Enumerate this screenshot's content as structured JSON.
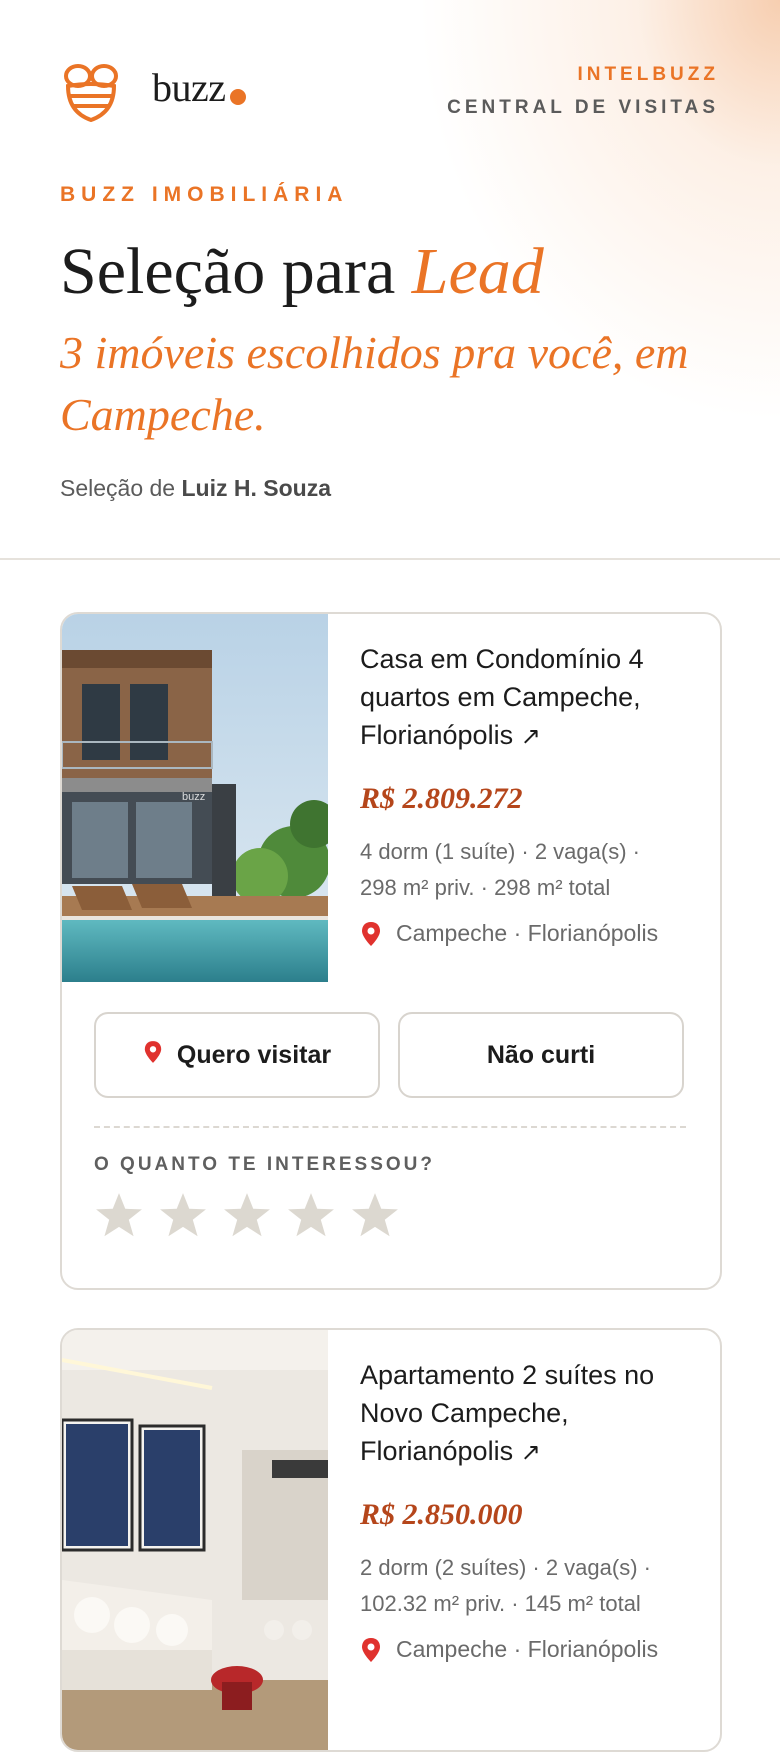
{
  "header": {
    "logo_text": "buzz",
    "brand": "INTELBUZZ",
    "brand_subtitle": "CENTRAL DE VISITAS",
    "agency": "BUZZ IMOBILIÁRIA",
    "headline_prefix": "Seleção para ",
    "headline_name": "Lead",
    "subheadline": "3 imóveis escolhidos pra você, em Campeche.",
    "curator_prefix": "Seleção de ",
    "curator_name": "Luiz H. Souza"
  },
  "colors": {
    "accent": "#ea7426",
    "price": "#b5461b",
    "text": "#1c1c1c",
    "muted": "#6a6a6a",
    "star_empty": "#dcd8d0"
  },
  "listings": [
    {
      "title": "Casa em Condomínio 4 quartos em Campeche, Florianópolis",
      "link_icon": "external-arrow-icon",
      "price": "R$ 2.809.272",
      "specs_line1": "4 dorm (1 suíte) · 2 vaga(s) ·",
      "specs_line2": "298 m² priv. · 298 m² total",
      "location": "Campeche · Florianópolis",
      "photo_watermark": "buzz",
      "visit_label": "Quero visitar",
      "dislike_label": "Não curti",
      "rating_label": "O QUANTO TE INTERESSOU?",
      "rating": 0,
      "rating_max": 5
    },
    {
      "title": "Apartamento 2 suítes no Novo Campeche, Florianópolis",
      "link_icon": "external-arrow-icon",
      "price": "R$ 2.850.000",
      "specs_line1": "2 dorm (2 suítes) · 2 vaga(s) ·",
      "specs_line2": "102.32 m² priv. · 145 m² total",
      "location": "Campeche · Florianópolis"
    }
  ]
}
